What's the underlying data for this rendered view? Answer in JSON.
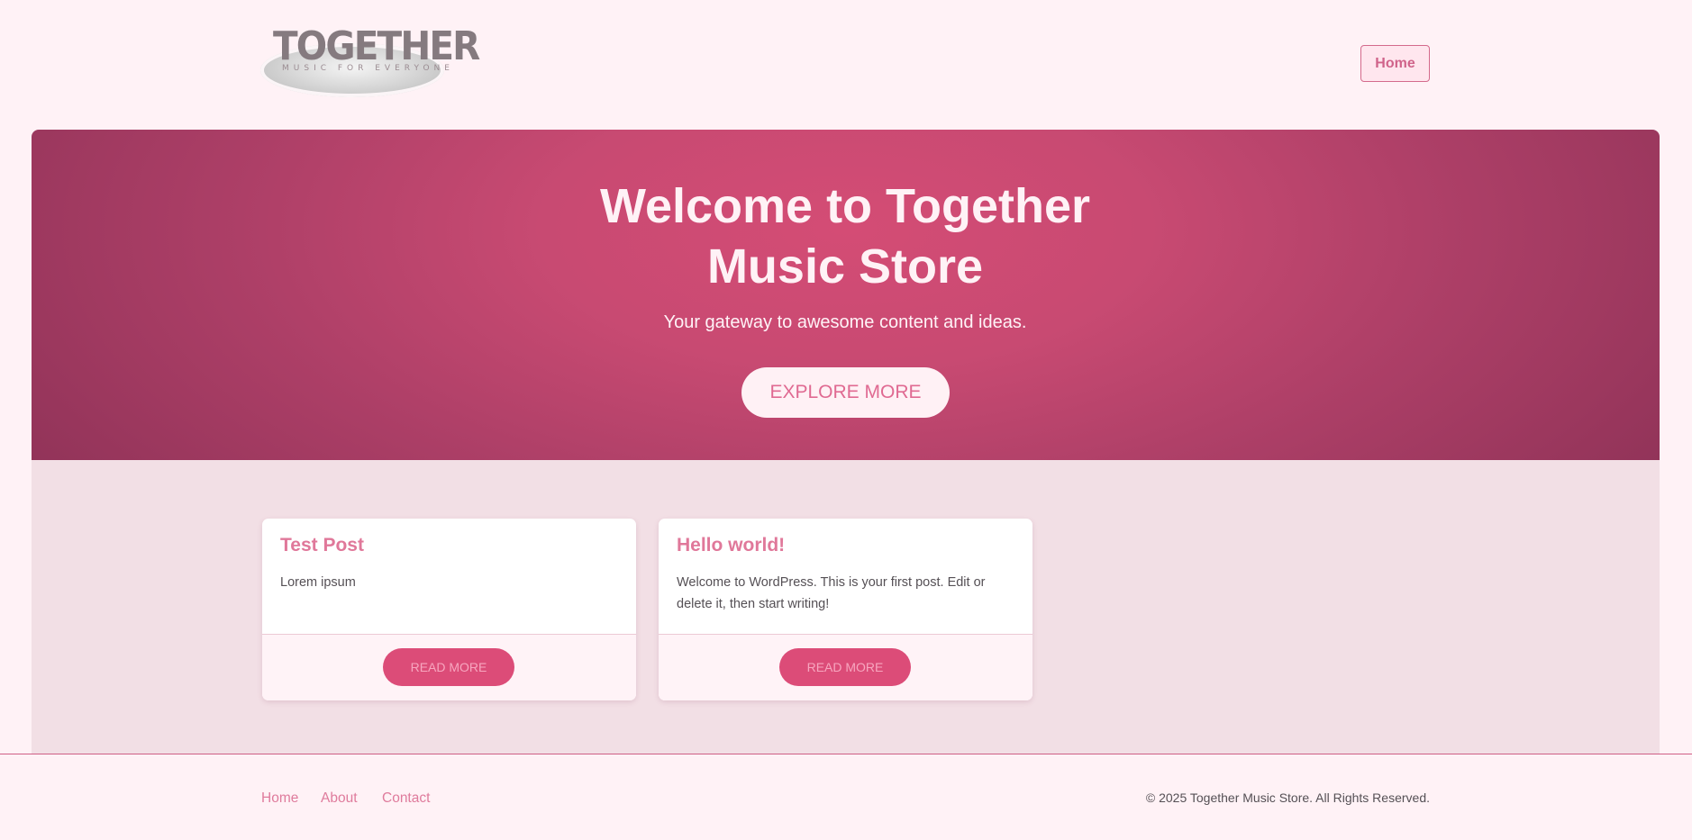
{
  "header": {
    "logo": {
      "wordmark": "TOGETHER",
      "tagline": "MUSIC FOR EVERYONE"
    },
    "nav": [
      {
        "label": "Home"
      }
    ]
  },
  "hero": {
    "title_line1": "Welcome to Together",
    "title_line2": "Music Store",
    "subtitle": "Your gateway to awesome content and ideas.",
    "cta_label": "EXPLORE MORE"
  },
  "posts": [
    {
      "title": "Test Post",
      "excerpt": "Lorem ipsum",
      "button_label": "READ MORE"
    },
    {
      "title": "Hello world!",
      "excerpt": "Welcome to WordPress. This is your first post. Edit or delete it, then start writing!",
      "button_label": "READ MORE"
    }
  ],
  "footer": {
    "links": [
      {
        "label": "Home"
      },
      {
        "label": "About"
      },
      {
        "label": "Contact"
      }
    ],
    "copyright": "© 2025 Together Music Store. All Rights Reserved."
  },
  "colors": {
    "page_bg": "#fff2f6",
    "hero_center": "#d44c75",
    "hero_edge": "#8e3257",
    "accent": "#dc4c78",
    "link": "#df7b9c",
    "posts_bg": "#f2dfe5"
  }
}
